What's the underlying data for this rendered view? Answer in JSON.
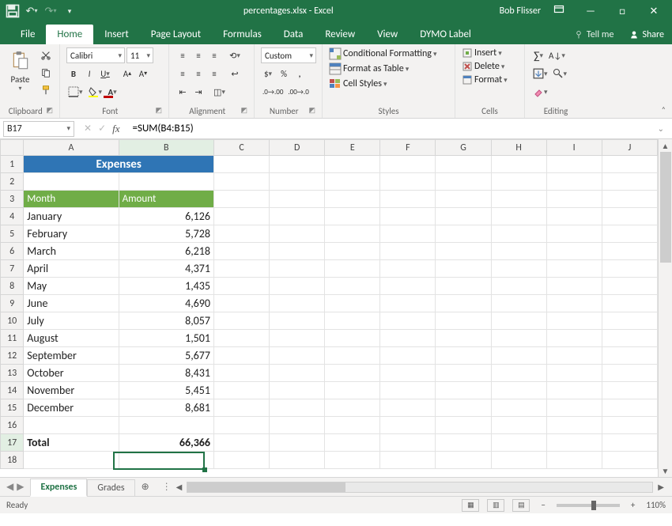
{
  "titlebar": {
    "filename": "percentages.xlsx - Excel",
    "user": "Bob Flisser"
  },
  "tabs": {
    "file": "File",
    "list": [
      "Home",
      "Insert",
      "Page Layout",
      "Formulas",
      "Data",
      "Review",
      "View",
      "DYMO Label"
    ],
    "active_index": 0,
    "tell_me": "Tell me",
    "share": "Share"
  },
  "ribbon": {
    "clipboard": {
      "paste": "Paste",
      "label": "Clipboard"
    },
    "font": {
      "name": "Calibri",
      "size": "11",
      "bold": "B",
      "italic": "I",
      "underline": "U",
      "label": "Font"
    },
    "alignment": {
      "label": "Alignment"
    },
    "number": {
      "format": "Custom",
      "label": "Number"
    },
    "styles": {
      "cond": "Conditional Formatting",
      "table": "Format as Table",
      "cell": "Cell Styles",
      "label": "Styles"
    },
    "cells": {
      "insert": "Insert",
      "delete": "Delete",
      "format": "Format",
      "label": "Cells"
    },
    "editing": {
      "label": "Editing"
    }
  },
  "namebox": "B17",
  "formula": "=SUM(B4:B15)",
  "columns": [
    "A",
    "B",
    "C",
    "D",
    "E",
    "F",
    "G",
    "H",
    "I",
    "J"
  ],
  "expenses_header": "Expenses",
  "col_headers": {
    "a": "Month",
    "b": "Amount"
  },
  "rows": [
    {
      "month": "January",
      "amount": "6,126"
    },
    {
      "month": "February",
      "amount": "5,728"
    },
    {
      "month": "March",
      "amount": "6,218"
    },
    {
      "month": "April",
      "amount": "4,371"
    },
    {
      "month": "May",
      "amount": "1,435"
    },
    {
      "month": "June",
      "amount": "4,690"
    },
    {
      "month": "July",
      "amount": "8,057"
    },
    {
      "month": "August",
      "amount": "1,501"
    },
    {
      "month": "September",
      "amount": "5,677"
    },
    {
      "month": "October",
      "amount": "8,431"
    },
    {
      "month": "November",
      "amount": "5,451"
    },
    {
      "month": "December",
      "amount": "8,681"
    }
  ],
  "total": {
    "label": "Total",
    "value": "66,366"
  },
  "sheet_tabs": {
    "active": "Expenses",
    "other": "Grades"
  },
  "status": {
    "ready": "Ready",
    "zoom": "110%"
  }
}
